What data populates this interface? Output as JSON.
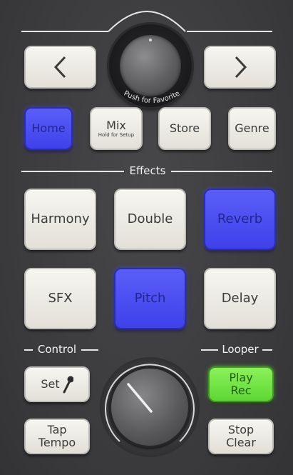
{
  "nav": {
    "prev_icon": "chevron-left-icon",
    "next_icon": "chevron-right-icon",
    "knob_caption": "Push for Favorite"
  },
  "top_row": {
    "home": "Home",
    "mix": "Mix",
    "mix_sub": "Hold for Setup",
    "store": "Store",
    "genre": "Genre"
  },
  "sections": {
    "effects": "Effects",
    "control": "Control",
    "looper": "Looper"
  },
  "effects": {
    "harmony": "Harmony",
    "double": "Double",
    "reverb": "Reverb",
    "sfx": "SFX",
    "pitch": "Pitch",
    "delay": "Delay"
  },
  "control": {
    "set": "Set",
    "set_icon": "microphone-icon",
    "tap": "Tap",
    "tempo": "Tempo"
  },
  "looper": {
    "play": "Play",
    "rec": "Rec",
    "stop": "Stop",
    "clear": "Clear"
  },
  "colors": {
    "lit_blue": "#4446ee",
    "lit_green": "#6fe040",
    "button_white": "#eeede6",
    "panel": "#3d3d3f"
  },
  "states": {
    "home_lit": true,
    "reverb_lit": true,
    "pitch_lit": true,
    "play_rec_lit": true
  }
}
